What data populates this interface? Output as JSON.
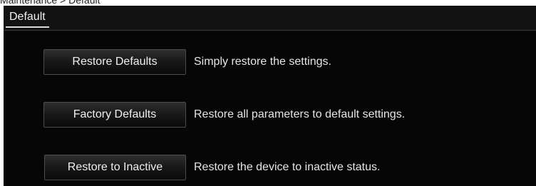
{
  "breadcrumb": "Maintenance > Default",
  "panel": {
    "tab_label": "Default"
  },
  "actions": [
    {
      "button_label": "Restore Defaults",
      "description": "Simply restore the settings."
    },
    {
      "button_label": "Factory Defaults",
      "description": "Restore all parameters to default settings."
    },
    {
      "button_label": "Restore to Inactive",
      "description": "Restore the device to inactive status."
    }
  ]
}
